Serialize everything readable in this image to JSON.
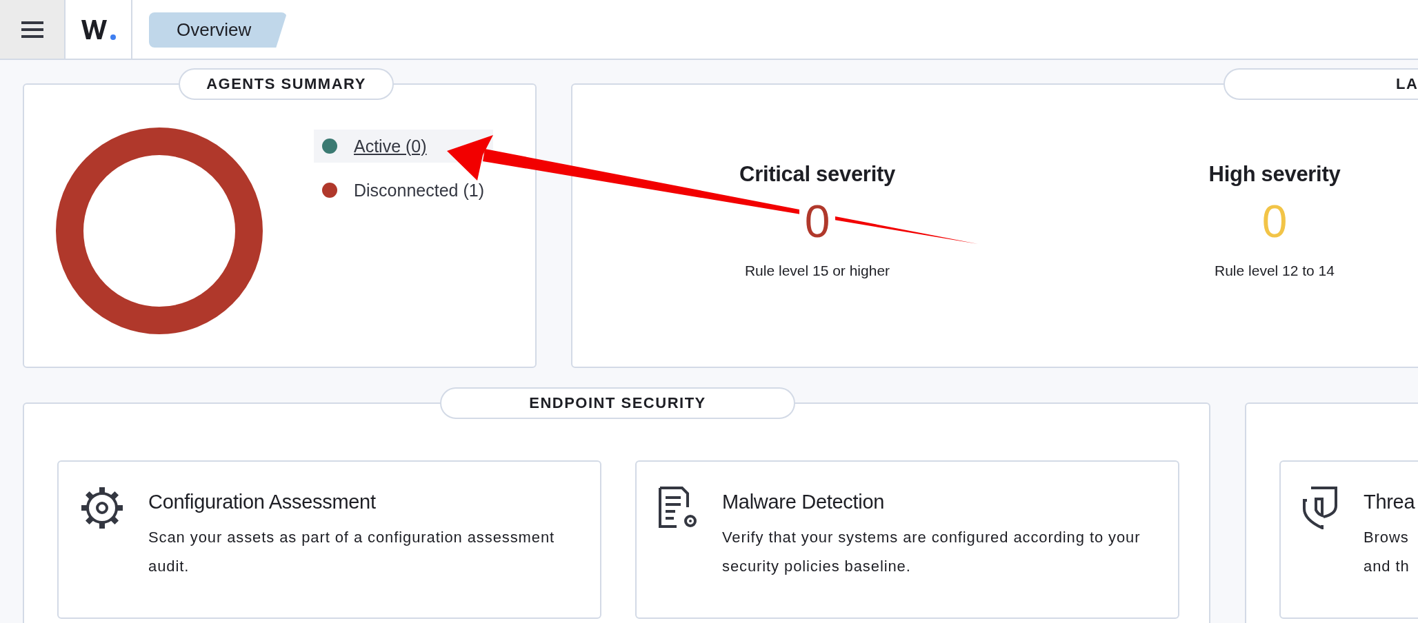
{
  "header": {
    "tabs": [
      {
        "label": "Overview",
        "selected": true
      }
    ]
  },
  "agents_summary": {
    "title": "AGENTS SUMMARY",
    "legend": [
      {
        "label": "Active (0)",
        "color": "#3b7a72",
        "highlighted": true
      },
      {
        "label": "Disconnected (1)",
        "color": "#b0382b",
        "highlighted": false
      }
    ]
  },
  "alerts": {
    "title": "LA",
    "items": [
      {
        "title": "Critical severity",
        "value": "0",
        "color": "#b0382b",
        "subtitle": "Rule level 15 or higher"
      },
      {
        "title": "High severity",
        "value": "0",
        "color": "#f2c447",
        "subtitle": "Rule level 12 to 14"
      }
    ]
  },
  "endpoint_security": {
    "title": "ENDPOINT SECURITY",
    "cards": [
      {
        "kind": "gear",
        "title": "Configuration Assessment",
        "description": "Scan your assets as part of a configuration assessment audit."
      },
      {
        "kind": "document",
        "title": "Malware Detection",
        "description": "Verify that your systems are configured according to your security policies baseline."
      }
    ]
  },
  "threat_panel": {
    "cards": [
      {
        "kind": "shield",
        "title": "Threa",
        "description_lines": [
          "Brows",
          "and th"
        ]
      }
    ]
  }
}
